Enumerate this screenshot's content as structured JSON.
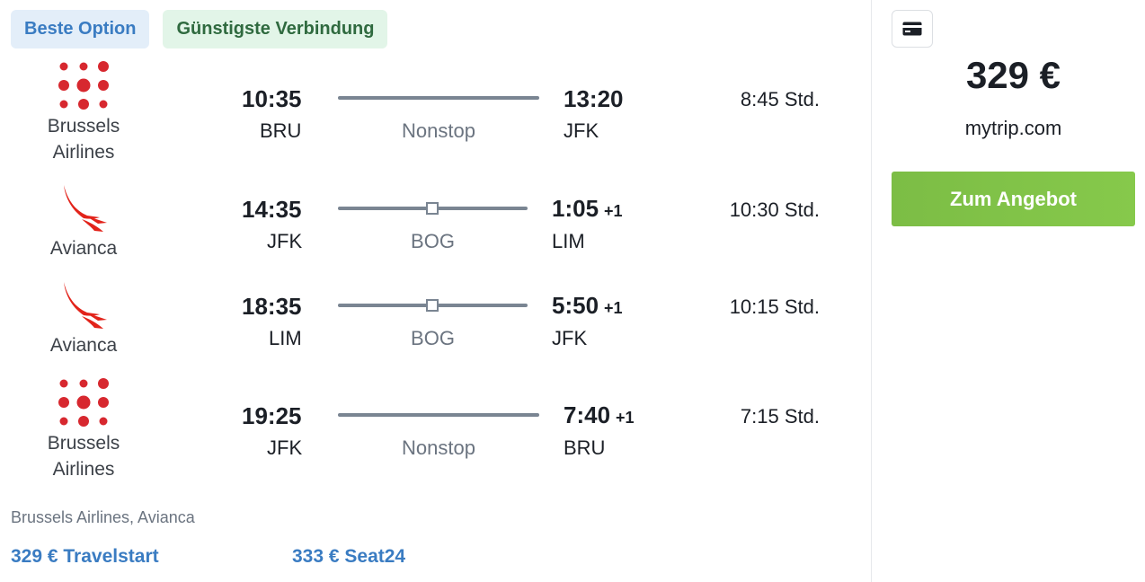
{
  "badges": {
    "best": "Beste Option",
    "cheapest": "Günstigste Verbindung"
  },
  "legs": [
    {
      "airline": [
        "Brussels",
        "Airlines"
      ],
      "logo": "brussels-airlines-logo",
      "dep_time": "10:35",
      "dep_code": "BRU",
      "stop": "Nonstop",
      "arr_time": "13:20",
      "arr_plus": "",
      "arr_code": "JFK",
      "duration": "8:45 Std."
    },
    {
      "airline": [
        "Avianca"
      ],
      "logo": "avianca-logo",
      "dep_time": "14:35",
      "dep_code": "JFK",
      "stop": "BOG",
      "arr_time": "1:05",
      "arr_plus": "+1",
      "arr_code": "LIM",
      "duration": "10:30 Std."
    },
    {
      "airline": [
        "Avianca"
      ],
      "logo": "avianca-logo",
      "dep_time": "18:35",
      "dep_code": "LIM",
      "stop": "BOG",
      "arr_time": "5:50",
      "arr_plus": "+1",
      "arr_code": "JFK",
      "duration": "10:15 Std."
    },
    {
      "airline": [
        "Brussels",
        "Airlines"
      ],
      "logo": "brussels-airlines-logo",
      "dep_time": "19:25",
      "dep_code": "JFK",
      "stop": "Nonstop",
      "arr_time": "7:40",
      "arr_plus": "+1",
      "arr_code": "BRU",
      "duration": "7:15 Std."
    }
  ],
  "carriers": "Brussels Airlines, Avianca",
  "alt_offers": [
    "329 € Travelstart",
    "333 € Seat24"
  ],
  "side": {
    "icon": "credit-card-icon",
    "price": "329 €",
    "provider": "mytrip.com",
    "cta": "Zum Angebot"
  },
  "colors": {
    "accent_green": "#7cbd45",
    "link_blue": "#3a7cc2",
    "brussels_red": "#d7282f",
    "avianca_red": "#e2231a"
  }
}
